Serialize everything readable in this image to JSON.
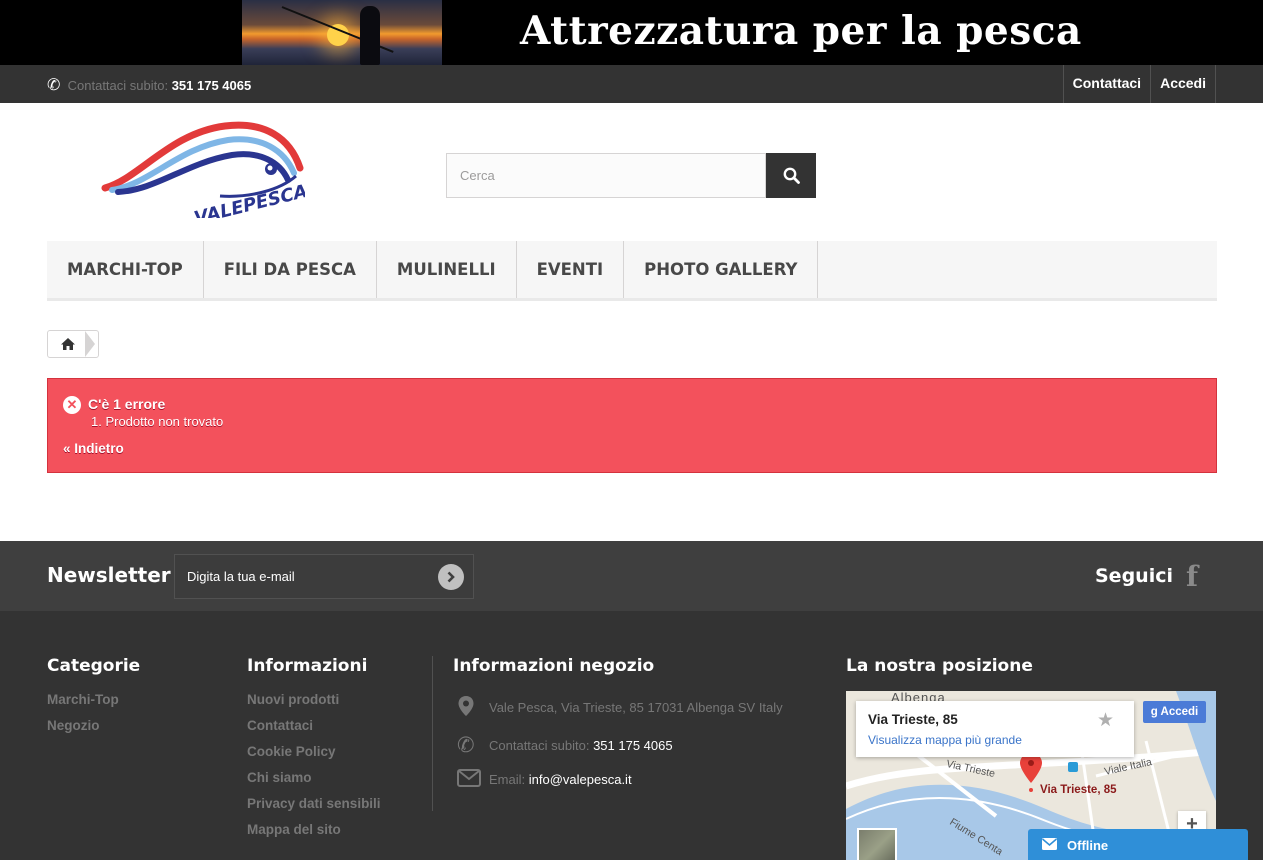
{
  "banner": {
    "title": "Attrezzatura per la pesca"
  },
  "topbar": {
    "contact_label": "Contattaci subito:",
    "phone": "351 175 4065",
    "links": [
      "Contattaci",
      "Accedi"
    ]
  },
  "logo": {
    "text": "VALEPESCA"
  },
  "search": {
    "placeholder": "Cerca"
  },
  "menu": {
    "items": [
      "MARCHI-TOP",
      "FILI DA PESCA",
      "MULINELLI",
      "EVENTI",
      "PHOTO GALLERY"
    ]
  },
  "error": {
    "title": "C'è 1 errore",
    "item": "1. Prodotto non trovato",
    "back": "« Indietro"
  },
  "newsletter": {
    "title": "Newsletter",
    "placeholder": "Digita la tua e-mail",
    "follow": "Seguici"
  },
  "footer": {
    "categories": {
      "title": "Categorie",
      "items": [
        "Marchi-Top",
        "Negozio"
      ]
    },
    "info": {
      "title": "Informazioni",
      "items": [
        "Nuovi prodotti",
        "Contattaci",
        "Cookie Policy",
        "Chi siamo",
        "Privacy dati sensibili",
        "Mappa del sito"
      ]
    },
    "store": {
      "title": "Informazioni negozio",
      "address": "Vale Pesca, Via Trieste, 85 17031 Albenga SV Italy",
      "phone_label": "Contattaci subito:",
      "phone": "351 175 4065",
      "email_label": "Email:",
      "email": "info@valepesca.it"
    },
    "map": {
      "title": "La nostra posizione",
      "place": "Via Trieste, 85",
      "view_larger": "Visualizza mappa più grande",
      "signin": "Accedi",
      "pin_label": "Via Trieste, 85",
      "streets": [
        "Albenga",
        "Via Trieste",
        "Viale Italia",
        "Fiume Centa"
      ],
      "zoom_in": "+"
    }
  },
  "chat": {
    "status": "Offline"
  },
  "colors": {
    "error_bg": "#f3515c",
    "dark": "#333333",
    "chat": "#2f8fd8",
    "map_link": "#3a74c9"
  }
}
